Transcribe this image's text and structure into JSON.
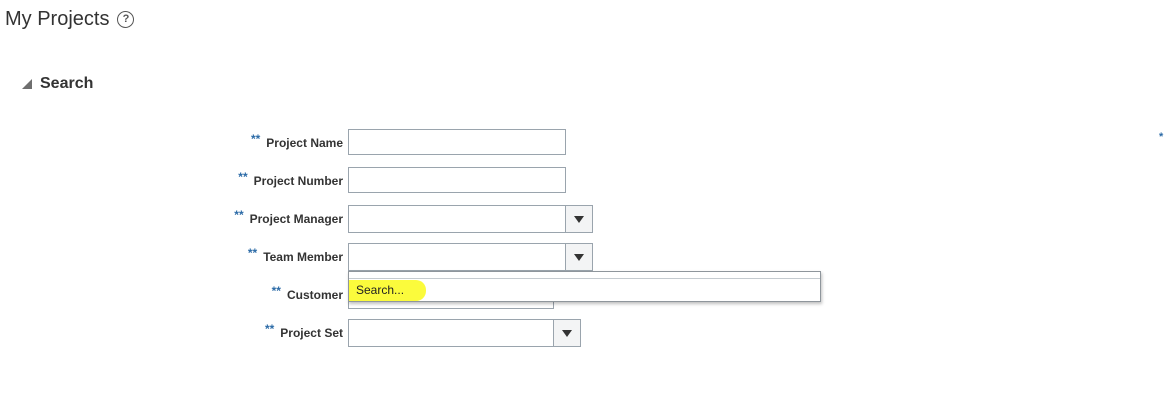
{
  "page": {
    "title": "My Projects"
  },
  "search": {
    "title": "Search",
    "required_marker": "**",
    "corner_marker": "*",
    "fields": [
      {
        "label": "Project Name",
        "value": ""
      },
      {
        "label": "Project Number",
        "value": ""
      },
      {
        "label": "Project Manager",
        "value": ""
      },
      {
        "label": "Team Member",
        "value": ""
      },
      {
        "label": "Customer",
        "value": ""
      },
      {
        "label": "Project Set",
        "value": ""
      }
    ]
  },
  "dropdown": {
    "placeholder": "Search..."
  },
  "icons": {
    "help": "help-circle-icon",
    "collapse": "collapse-triangle-icon",
    "dropdown": "chevron-down-icon"
  }
}
